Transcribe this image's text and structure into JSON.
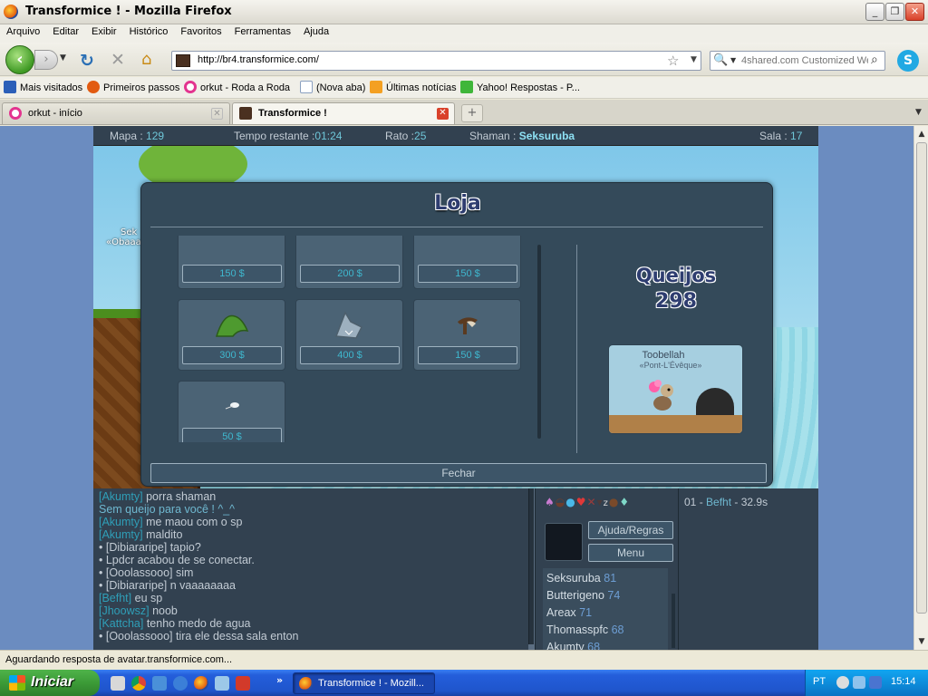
{
  "window": {
    "title": "Transformice ! - Mozilla Firefox"
  },
  "menu": [
    "Arquivo",
    "Editar",
    "Exibir",
    "Histórico",
    "Favoritos",
    "Ferramentas",
    "Ajuda"
  ],
  "nav": {
    "url": "http://br4.transformice.com/",
    "search_placeholder": "4shared.com Customized We"
  },
  "bookmarks": [
    {
      "label": "Mais visitados",
      "icon": "bookmarks-folder-icon",
      "color": "#2b5fb8"
    },
    {
      "label": "Primeiros passos",
      "icon": "firefox-icon",
      "color": "#e25b11"
    },
    {
      "label": "orkut - Roda a Roda",
      "icon": "orkut-icon",
      "color": "#e3348f"
    },
    {
      "label": "(Nova aba)",
      "icon": "page-icon",
      "color": "#c8d4e6"
    },
    {
      "label": "Últimas notícias",
      "icon": "rss-icon",
      "color": "#f4a022"
    },
    {
      "label": "Yahoo! Respostas - P...",
      "icon": "yahoo-answers-icon",
      "color": "#3fb63a"
    }
  ],
  "tabs": [
    {
      "label": "orkut - início",
      "icon": "orkut-icon",
      "active": false
    },
    {
      "label": "Transformice !",
      "icon": "transformice-icon",
      "active": true
    }
  ],
  "hud": {
    "map_label": "Mapa :",
    "map_value": "129",
    "time_label": "Tempo restante :",
    "time_value": "01:24",
    "mice_label": "Rato :",
    "mice_value": "25",
    "shaman_label": "Shaman :",
    "shaman_value": "Seksuruba",
    "room_label": "Sala :",
    "room_value": "17"
  },
  "stage": {
    "sign_line1": "Sek",
    "sign_line2": "«Obaaaa"
  },
  "shop": {
    "title": "Loja",
    "items": [
      {
        "price": "150 $",
        "icon": "partial-item-icon"
      },
      {
        "price": "200 $",
        "icon": "bat-wings-icon"
      },
      {
        "price": "150 $",
        "icon": "partial-item-icon"
      },
      {
        "price": "300 $",
        "icon": "green-hat-icon"
      },
      {
        "price": "400 $",
        "icon": "shark-hat-icon"
      },
      {
        "price": "150 $",
        "icon": "mustache-icon"
      },
      {
        "price": "50 $",
        "icon": "feather-icon"
      }
    ],
    "cheese_label": "Queijos",
    "cheese_count": "298",
    "preview_name": "Toobellah",
    "preview_title": "«Pont-L'Évêque»",
    "close_label": "Fechar"
  },
  "chat": [
    {
      "nick": "[Akumty]",
      "text": "porra shaman",
      "kind": "nick"
    },
    {
      "nick": "",
      "text": "Sem queijo para você ! ^_^",
      "kind": "sys"
    },
    {
      "nick": "[Akumty]",
      "text": "me maou com o sp",
      "kind": "nick"
    },
    {
      "nick": "[Akumty]",
      "text": "maldito",
      "kind": "nick"
    },
    {
      "nick": "",
      "text": "• [Dibiararipe] tapio?",
      "kind": "plain"
    },
    {
      "nick": "",
      "text": "• Lpdcr acabou de se conectar.",
      "kind": "plain"
    },
    {
      "nick": "",
      "text": "• [Ooolassooo] sim",
      "kind": "plain"
    },
    {
      "nick": "",
      "text": "• [Dibiararipe] n vaaaaaaaa",
      "kind": "plain"
    },
    {
      "nick": "[Befht]",
      "text": "eu sp",
      "kind": "nick"
    },
    {
      "nick": "[Jhoowsz]",
      "text": "noob",
      "kind": "nick"
    },
    {
      "nick": "[Kattcha]",
      "text": "tenho medo de agua",
      "kind": "nick"
    },
    {
      "nick": "",
      "text": "• [Ooolassooo] tira ele dessa sala enton",
      "kind": "plain"
    }
  ],
  "side": {
    "help_label": "Ajuda/Regras",
    "menu_label": "Menu"
  },
  "players": [
    {
      "name": "Seksuruba",
      "score": "81"
    },
    {
      "name": "Butterigeno",
      "score": "74"
    },
    {
      "name": "Areax",
      "score": "71"
    },
    {
      "name": "Thomasspfc",
      "score": "68"
    },
    {
      "name": "Akumty",
      "score": "68"
    }
  ],
  "ranking": {
    "rank": "01",
    "sep": " - ",
    "name": "Befht",
    "time": " - 32.9s"
  },
  "status": "Aguardando resposta de avatar.transformice.com...",
  "taskbar": {
    "start_label": "Iniciar",
    "task_label": "Transformice ! - Mozill...",
    "lang": "PT",
    "clock": "15:14"
  }
}
